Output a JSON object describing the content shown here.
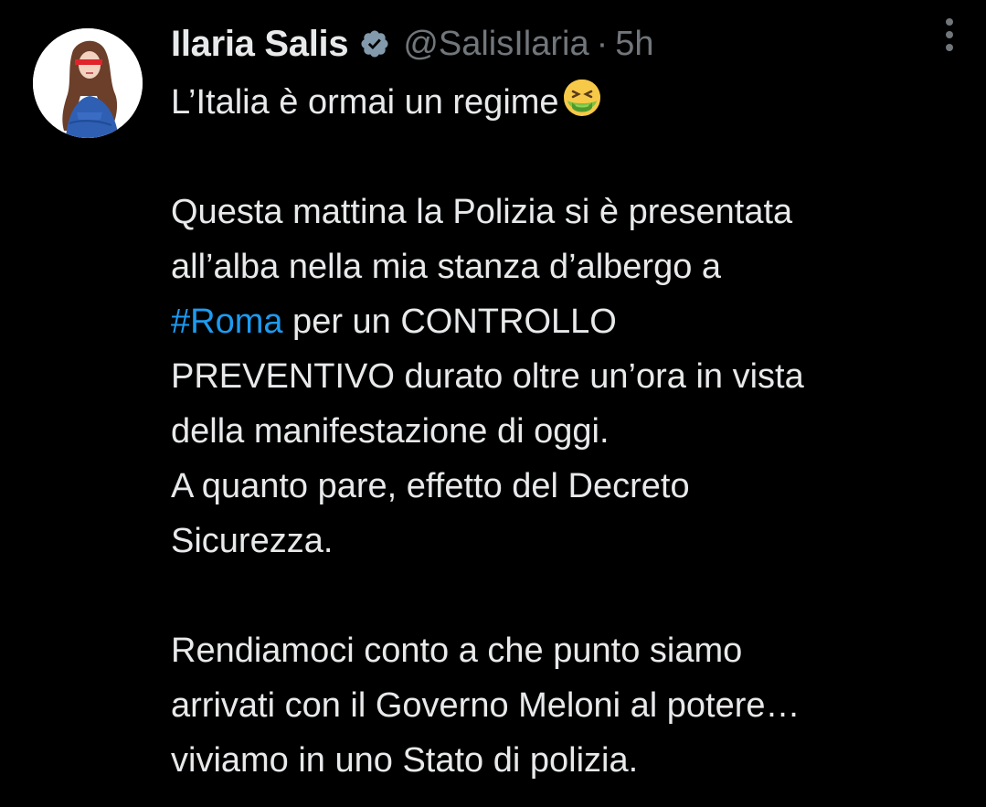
{
  "tweet": {
    "display_name": "Ilaria Salis",
    "handle": "@SalisIlaria",
    "separator": "·",
    "time": "5h",
    "avatar_icon": "avatar-illustration",
    "verified_icon": "verified-badge-icon",
    "more_icon": "more-options-icon",
    "emoji_icon": "nauseated-face-emoji",
    "line1": "L’Italia è ormai un regime",
    "line2": "Questa mattina la Polizia si è presentata",
    "line3": "all’alba nella mia stanza d’albergo a",
    "hashtag": "#Roma",
    "line4_rest": " per un CONTROLLO",
    "line5": "PREVENTIVO durato oltre un’ora in vista",
    "line6": "della manifestazione di oggi.",
    "line7": "A quanto pare, effetto del Decreto",
    "line8": "Sicurezza.",
    "line9": "Rendiamoci conto a che punto siamo",
    "line10": "arrivati con il Governo Meloni al potere…",
    "line11": "viviamo in uno Stato di polizia."
  },
  "colors": {
    "background": "#000000",
    "text": "#e7e9ea",
    "secondary": "#71767b",
    "link": "#1d9bf0",
    "verified": "#829aab"
  }
}
